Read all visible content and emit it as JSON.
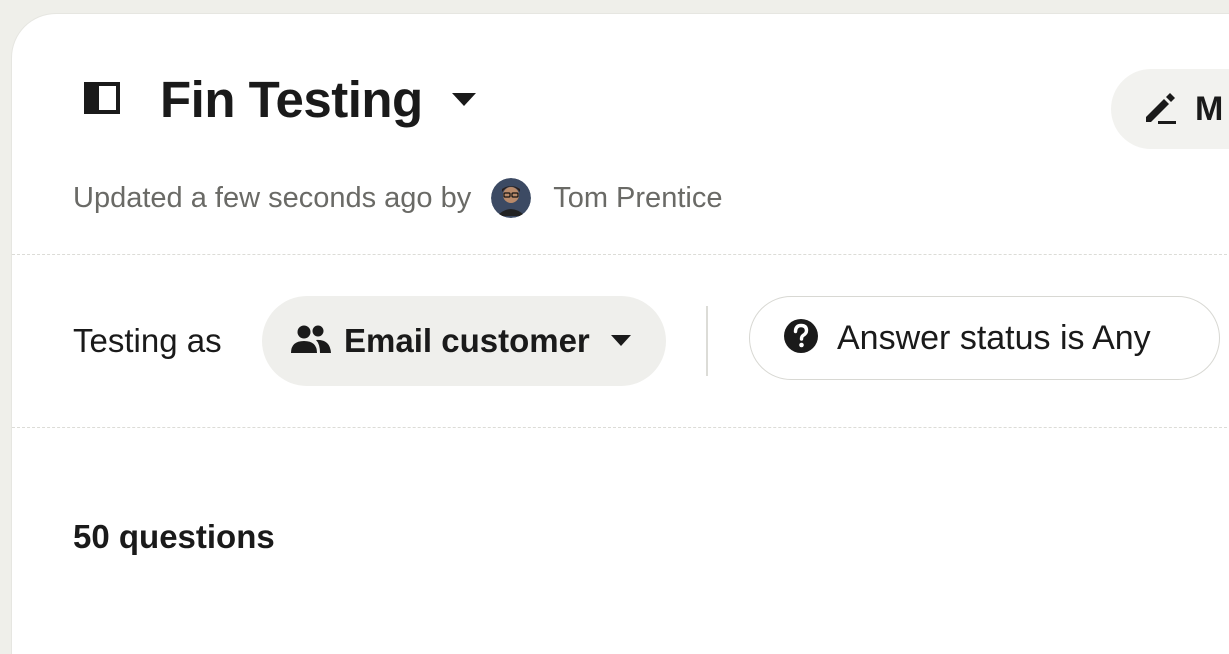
{
  "header": {
    "title": "Fin Testing",
    "edit_button_label": "M"
  },
  "meta": {
    "updated_text": "Updated a few seconds ago by",
    "author_name": "Tom Prentice"
  },
  "toolbar": {
    "testing_as_label": "Testing as",
    "persona_value": "Email customer",
    "filter_label": "Answer status is Any"
  },
  "content": {
    "question_count": "50 questions"
  },
  "icons": {
    "sidebar_toggle": "sidebar-toggle-icon",
    "title_caret": "caret-down-icon",
    "edit": "pencil-icon",
    "persona": "people-icon",
    "persona_caret": "caret-down-icon",
    "filter": "question-circle-icon"
  },
  "colors": {
    "background": "#efefea",
    "panel": "#ffffff",
    "text": "#1a1a1a",
    "muted_text": "#6a6a66",
    "pill_fill": "#efefec",
    "divider": "#dcdcd7"
  }
}
